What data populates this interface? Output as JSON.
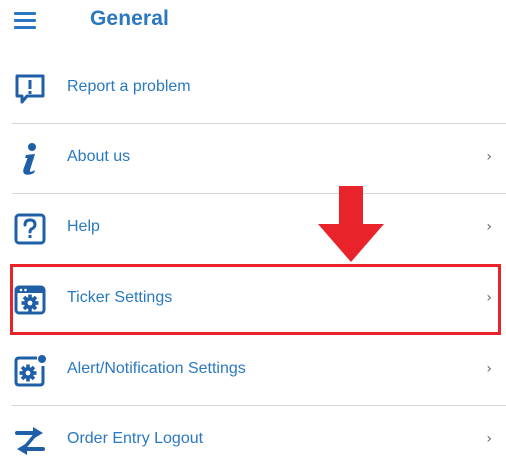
{
  "header": {
    "menu_icon": "hamburger-menu-icon",
    "title": "General"
  },
  "colors": {
    "accent": "#2a78c2",
    "icon": "#1f5fa8",
    "highlight": "#e8232a",
    "divider": "#d6d6d6"
  },
  "items": [
    {
      "label": "Report a problem",
      "icon": "report-problem-icon",
      "chevron": ""
    },
    {
      "label": "About us",
      "icon": "info-icon",
      "chevron": "›"
    },
    {
      "label": "Help",
      "icon": "help-icon",
      "chevron": "›"
    },
    {
      "label": "Ticker Settings",
      "icon": "ticker-settings-icon",
      "chevron": "›",
      "highlighted": true
    },
    {
      "label": "Alert/Notification Settings",
      "icon": "alert-notification-settings-icon",
      "chevron": "›"
    },
    {
      "label": "Order Entry Logout",
      "icon": "order-entry-logout-icon",
      "chevron": "›"
    }
  ],
  "annotation": {
    "arrow_icon": "down-arrow-icon",
    "box": "highlight-box"
  }
}
